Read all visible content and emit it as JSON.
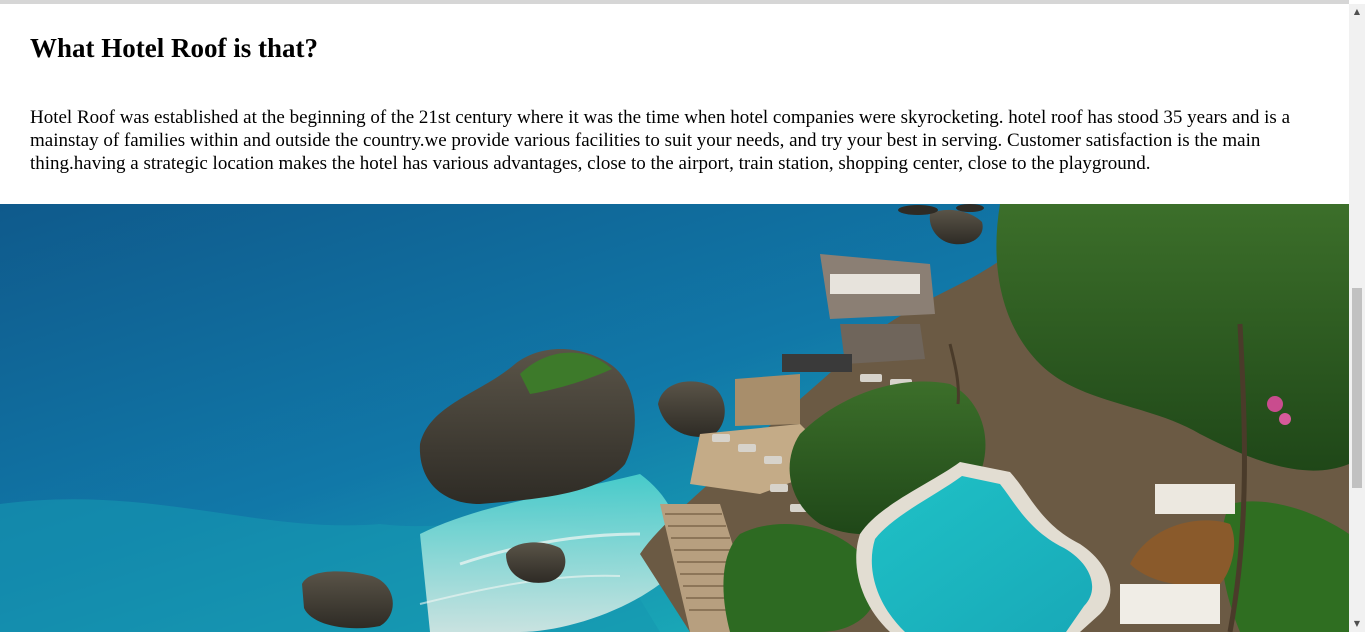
{
  "section": {
    "title": "What Hotel Roof is that?",
    "paragraph": "Hotel Roof was established at the beginning of the 21st century where it was the time when hotel companies were skyrocketing. hotel roof has stood 35 years and is a mainstay of families within and outside the country.we provide various facilities to suit your needs, and try your best in serving. Customer satisfaction is the main thing.having a strategic location makes the hotel has various advantages, close to the airport, train station, shopping center, close to the playground."
  },
  "hero_image": {
    "alt": "Cliffside resort with infinity pool overlooking turquoise sea and rocks"
  },
  "scrollbar": {
    "up_icon": "triangle-up-icon",
    "down_icon": "triangle-down-icon"
  }
}
